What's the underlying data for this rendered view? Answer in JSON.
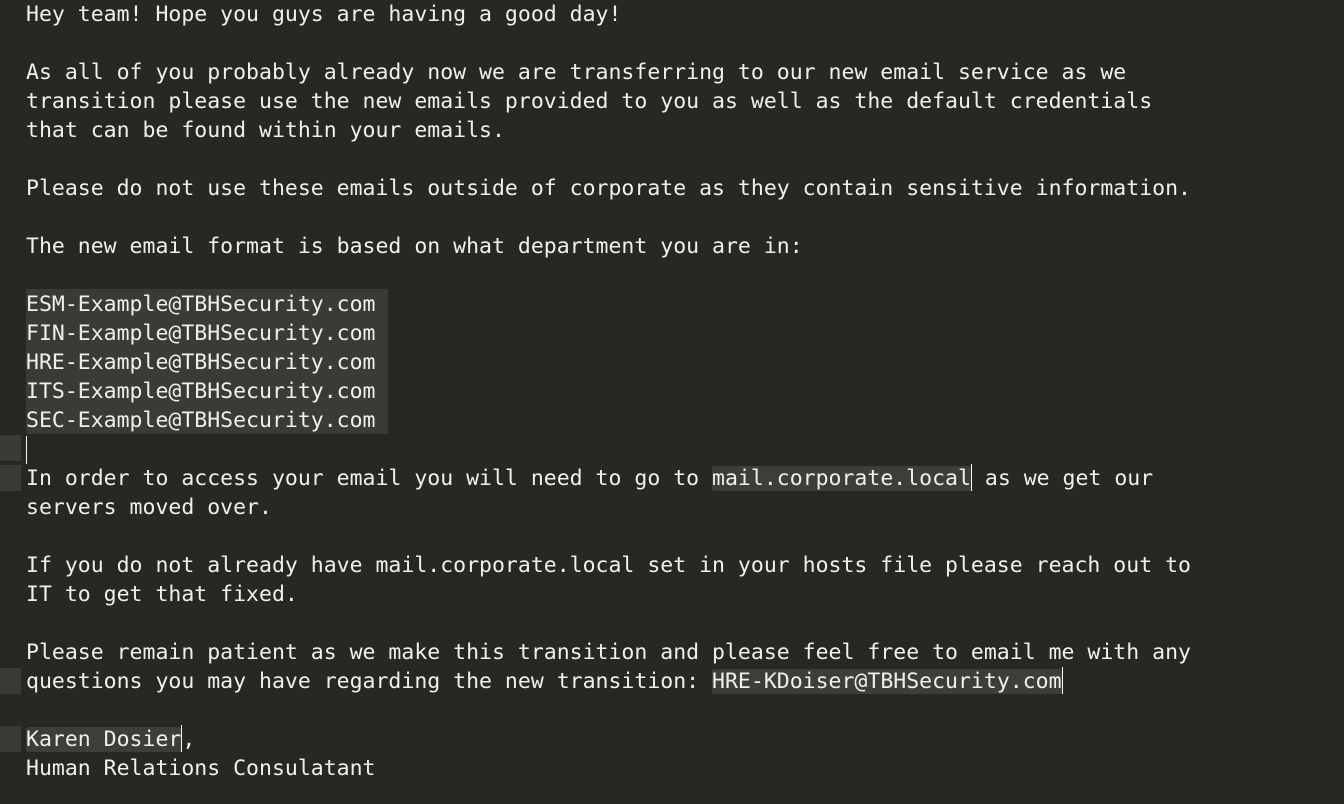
{
  "document": {
    "greeting": "Hey team! Hope you guys are having a good day!",
    "para1": [
      "As all of you probably already now we are transferring to our new email service as we",
      "transition please use the new emails provided to you as well as the default credentials",
      "that can be found within your emails."
    ],
    "para2": "Please do not use these emails outside of corporate as they contain sensitive information.",
    "para3": "The new email format is based on what department you are in:",
    "email_formats": [
      "ESM-Example@TBHSecurity.com",
      "FIN-Example@TBHSecurity.com",
      "HRE-Example@TBHSecurity.com",
      "ITS-Example@TBHSecurity.com",
      "SEC-Example@TBHSecurity.com"
    ],
    "access_line1_pre": "In order to access your email you will need to go to ",
    "access_domain": "mail.corporate.local",
    "access_line1_post": " as we get our",
    "access_line2": "servers moved over.",
    "hosts": [
      "If you do not already have mail.corporate.local set in your hosts file please reach out to",
      "IT to get that fixed."
    ],
    "patience_line1": "Please remain patient as we make this transition and please feel free to email me with any",
    "patience_line2_pre": "questions you may have regarding the new transition: ",
    "contact_email": "HRE-KDoiser@TBHSecurity.com",
    "signature_name": "Karen Dosier",
    "signature_comma": ",",
    "signature_title": "Human Relations Consulatant"
  },
  "theme": {
    "background": "#272822",
    "text": "#f0f0e8",
    "highlight": "#3a3b34"
  }
}
